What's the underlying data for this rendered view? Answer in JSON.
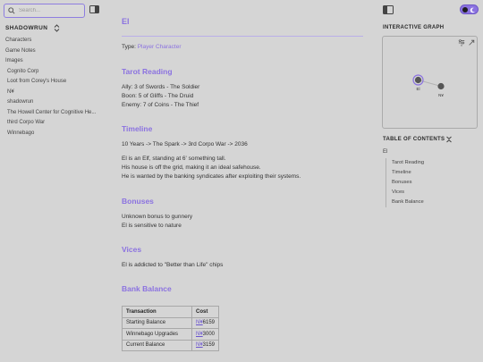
{
  "search": {
    "placeholder": "Search..."
  },
  "sidebar": {
    "site_title": "SHADOWRUN",
    "items": [
      {
        "label": "Characters"
      },
      {
        "label": "Game Notes"
      },
      {
        "label": "Images"
      },
      {
        "label": "Cognito Corp"
      },
      {
        "label": "Loot from Corey's House"
      },
      {
        "label": "N¥"
      },
      {
        "label": "shadowrun"
      },
      {
        "label": "The Howell Center for Cognitive He..."
      },
      {
        "label": "third Corpo War"
      },
      {
        "label": "Winnebago"
      }
    ]
  },
  "page": {
    "title": "El",
    "type_label": "Type:",
    "type_value": "Player Character",
    "sections": {
      "tarot": {
        "heading": "Tarot Reading",
        "lines": [
          "Ally: 3 of Swords - The Soldier",
          "Boon: 5 of Gliffs - The Druid",
          "Enemy: 7 of Coins - The Thief"
        ]
      },
      "timeline": {
        "heading": "Timeline",
        "line1": "10 Years -> The Spark -> 3rd Corpo War -> 2036",
        "lines": [
          "El is an Elf, standing at 6' something tall.",
          "His house is off the grid, making it an ideal safehouse.",
          "He is wanted by the banking syndicates after exploiting their systems."
        ]
      },
      "bonuses": {
        "heading": "Bonuses",
        "lines": [
          "Unknown bonus to gunnery",
          "El is sensitive to nature"
        ]
      },
      "vices": {
        "heading": "Vices",
        "line": "El is addicted to \"Better than Life\" chips"
      },
      "bank": {
        "heading": "Bank Balance",
        "columns": [
          "Transaction",
          "Cost"
        ],
        "rows": [
          {
            "transaction": "Starting Balance",
            "currency": "N¥",
            "amount": "6159"
          },
          {
            "transaction": "Winnebago Upgrades",
            "currency": "N¥",
            "amount": "3000"
          },
          {
            "transaction": "Current Balance",
            "currency": "N¥",
            "amount": "3159"
          }
        ]
      }
    }
  },
  "right_panel": {
    "graph_heading": "INTERACTIVE GRAPH",
    "graph_nodes": [
      {
        "label": "El"
      },
      {
        "label": "N¥"
      }
    ],
    "toc_heading": "TABLE OF CONTENTS",
    "toc_root": "El",
    "toc_items": [
      "Tarot Reading",
      "Timeline",
      "Bonuses",
      "Vices",
      "Bank Balance"
    ]
  },
  "colors": {
    "accent": "#8b72e0",
    "background": "#d5d5d5",
    "link": "#6a54d0"
  },
  "icons": [
    "search-icon",
    "sidebar-toggle-icon",
    "chevron-updown-icon",
    "theme-toggle-moon-icon",
    "graph-settings-icon",
    "expand-icon",
    "collapse-icon"
  ]
}
